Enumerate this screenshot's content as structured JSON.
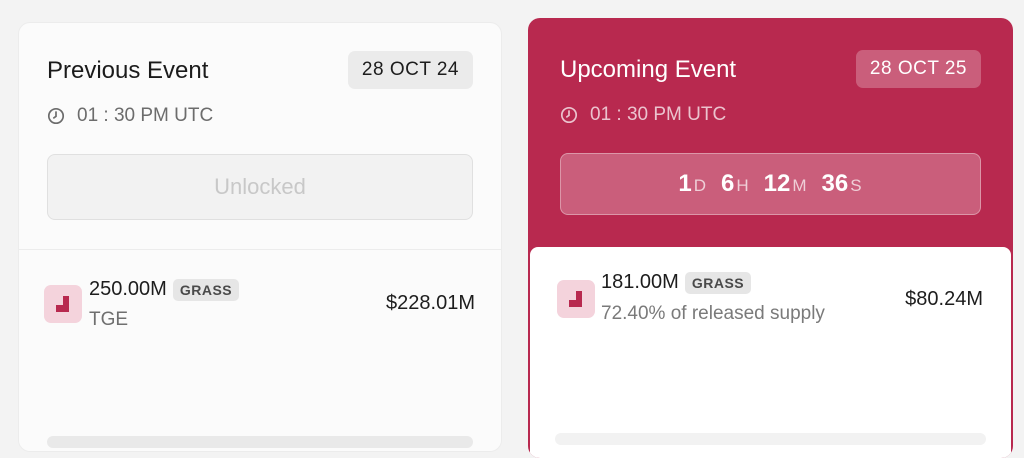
{
  "previous": {
    "title": "Previous Event",
    "date": "28 OCT 24",
    "time": "01 : 30 PM UTC",
    "status_label": "Unlocked",
    "amount": "250.00M",
    "token": "GRASS",
    "subtitle": "TGE",
    "usd_value": "$228.01M",
    "clock_icon": "clock-icon",
    "token_icon": "grass-token-icon"
  },
  "upcoming": {
    "title": "Upcoming Event",
    "date": "28 OCT 25",
    "time": "01 : 30 PM UTC",
    "countdown": {
      "days": "1",
      "days_unit": "D",
      "hours": "6",
      "hours_unit": "H",
      "minutes": "12",
      "minutes_unit": "M",
      "seconds": "36",
      "seconds_unit": "S"
    },
    "amount": "181.00M",
    "token": "GRASS",
    "subtitle": "72.40% of released supply",
    "usd_value": "$80.24M",
    "clock_icon": "clock-icon",
    "token_icon": "grass-token-icon"
  },
  "colors": {
    "accent": "#b8294f",
    "token_bg": "#f4d3dc",
    "token_fg": "#b8294f"
  }
}
